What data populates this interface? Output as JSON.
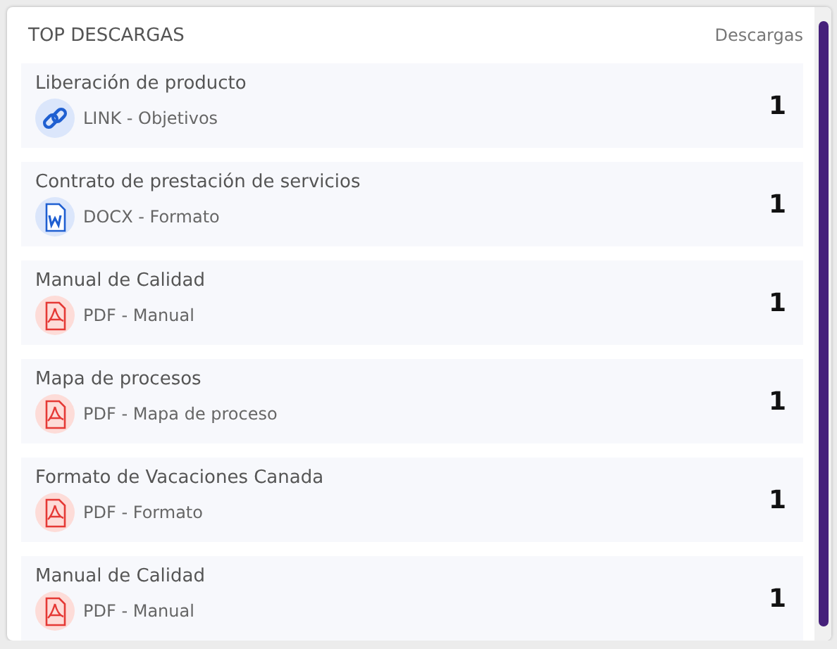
{
  "header": {
    "title": "TOP DESCARGAS",
    "column": "Descargas"
  },
  "items": [
    {
      "title": "Liberación de producto",
      "kind": "link",
      "subtitle": "LINK - Objetivos",
      "count": "1"
    },
    {
      "title": "Contrato de prestación de servicios",
      "kind": "docx",
      "subtitle": "DOCX - Formato",
      "count": "1"
    },
    {
      "title": "Manual de Calidad",
      "kind": "pdf",
      "subtitle": "PDF - Manual",
      "count": "1"
    },
    {
      "title": "Mapa de procesos",
      "kind": "pdf",
      "subtitle": "PDF - Mapa de proceso",
      "count": "1"
    },
    {
      "title": "Formato de Vacaciones Canada",
      "kind": "pdf",
      "subtitle": "PDF - Formato",
      "count": "1"
    },
    {
      "title": "Manual de Calidad",
      "kind": "pdf",
      "subtitle": "PDF - Manual",
      "count": "1"
    }
  ]
}
